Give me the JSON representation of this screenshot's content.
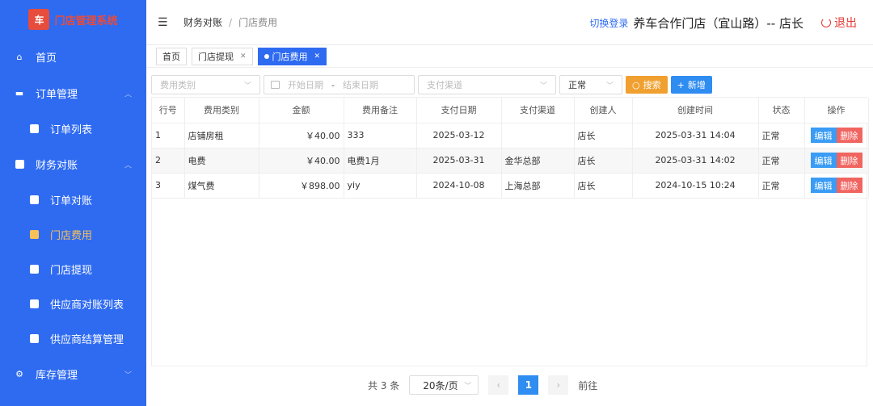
{
  "sidebar": {
    "logo_text": "门店管理系统",
    "items": [
      {
        "label": "首页",
        "icon": "home-icon"
      },
      {
        "label": "订单管理",
        "icon": "monitor-icon"
      },
      {
        "label": "订单列表"
      },
      {
        "label": "财务对账"
      },
      {
        "label": "订单对账"
      },
      {
        "label": "门店费用"
      },
      {
        "label": "门店提现"
      },
      {
        "label": "供应商对账列表"
      },
      {
        "label": "供应商结算管理"
      },
      {
        "label": "库存管理",
        "icon": "gear-icon"
      }
    ]
  },
  "header": {
    "breadcrumb": [
      "财务对账",
      "门店费用"
    ],
    "switch_login": "切换登录",
    "store": "养车合作门店（宜山路）-- 店长",
    "logout": "退出"
  },
  "tabs": [
    {
      "label": "首页"
    },
    {
      "label": "门店提现"
    },
    {
      "label": "门店费用"
    }
  ],
  "filters": {
    "category_placeholder": "费用类别",
    "start_date": "开始日期",
    "date_sep": "-",
    "end_date": "结束日期",
    "channel_placeholder": "支付渠道",
    "status_value": "正常",
    "search": "搜索",
    "add": "新增"
  },
  "table": {
    "headers": [
      "行号",
      "费用类别",
      "金额",
      "费用备注",
      "支付日期",
      "支付渠道",
      "创建人",
      "创建时间",
      "状态",
      "操作"
    ],
    "rows": [
      [
        "1",
        "店铺房租",
        "￥40.00",
        "333",
        "2025-03-12",
        "",
        "店长",
        "2025-03-31 14:04",
        "正常"
      ],
      [
        "2",
        "电费",
        "￥40.00",
        "电费1月",
        "2025-03-31",
        "金华总部",
        "店长",
        "2025-03-31 14:02",
        "正常"
      ],
      [
        "3",
        "煤气费",
        "￥898.00",
        "yiy",
        "2024-10-08",
        "上海总部",
        "店长",
        "2024-10-15 10:24",
        "正常"
      ]
    ],
    "edit": "编辑",
    "delete": "删除"
  },
  "pager": {
    "total": "共 3 条",
    "page_size": "20条/页",
    "current": "1",
    "goto": "前往"
  }
}
